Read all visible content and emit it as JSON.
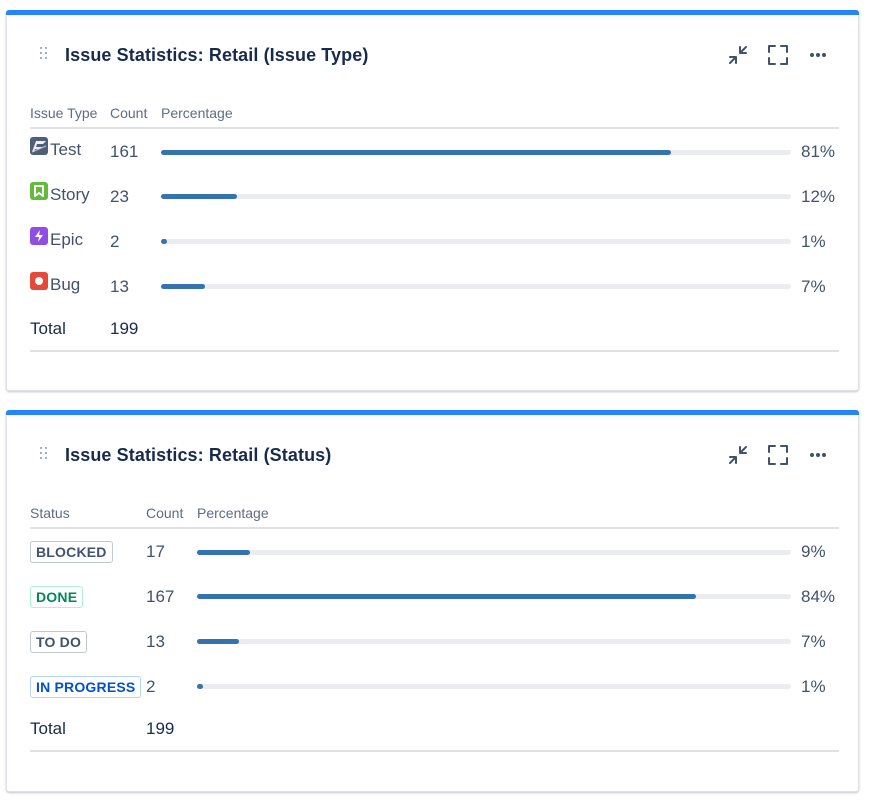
{
  "gadgets": [
    {
      "title": "Issue Statistics: Retail (Issue Type)",
      "columns": [
        "Issue Type",
        "Count",
        "Percentage"
      ],
      "rows": [
        {
          "label": "Test",
          "icon": "test-icon",
          "count": "161",
          "percent": "81%",
          "fill": 0.81
        },
        {
          "label": "Story",
          "icon": "story-icon",
          "count": "23",
          "percent": "12%",
          "fill": 0.12
        },
        {
          "label": "Epic",
          "icon": "epic-icon",
          "count": "2",
          "percent": "1%",
          "fill": 0.01
        },
        {
          "label": "Bug",
          "icon": "bug-icon",
          "count": "13",
          "percent": "7%",
          "fill": 0.07
        }
      ],
      "total_label": "Total",
      "total_count": "199"
    },
    {
      "title": "Issue Statistics: Retail (Status)",
      "columns": [
        "Status",
        "Count",
        "Percentage"
      ],
      "rows": [
        {
          "label": "BLOCKED",
          "style": "default",
          "count": "17",
          "percent": "9%",
          "fill": 0.09
        },
        {
          "label": "DONE",
          "style": "success",
          "count": "167",
          "percent": "84%",
          "fill": 0.84
        },
        {
          "label": "TO DO",
          "style": "default",
          "count": "13",
          "percent": "7%",
          "fill": 0.07
        },
        {
          "label": "IN PROGRESS",
          "style": "inprogress",
          "count": "2",
          "percent": "1%",
          "fill": 0.01
        }
      ],
      "total_label": "Total",
      "total_count": "199"
    }
  ],
  "colors": {
    "accent": "#2684ff",
    "bar": "#3572b0",
    "story": "#63ba3c",
    "epic": "#904ee2",
    "bug": "#e5493a"
  }
}
